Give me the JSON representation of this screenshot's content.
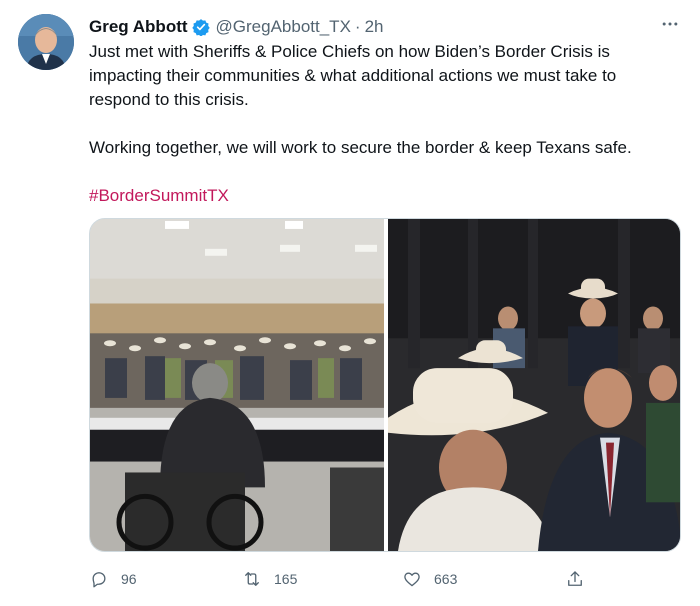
{
  "author": {
    "name": "Greg Abbott",
    "handle": "@GregAbbott_TX",
    "separator": "·",
    "time": "2h"
  },
  "tweet": {
    "paragraph1": "Just met with Sheriffs & Police Chiefs on how Biden’s Border Crisis is impacting their communities & what additional actions we must take to respond to this crisis.",
    "paragraph2": "Working together, we will work to secure the border & keep Texans safe.",
    "hashtag": "#BorderSummitTX"
  },
  "media": {
    "photos": [
      "conference-room-photo",
      "attendees-in-cowboy-hats-photo"
    ]
  },
  "actions": {
    "replies": "96",
    "retweets": "165",
    "likes": "663"
  },
  "colors": {
    "hashtag": "#c2185b",
    "verified": "#1d9bf0",
    "muted": "#536471"
  },
  "icons": [
    "verified-badge-icon",
    "more-icon",
    "reply-icon",
    "retweet-icon",
    "like-icon",
    "share-icon"
  ]
}
